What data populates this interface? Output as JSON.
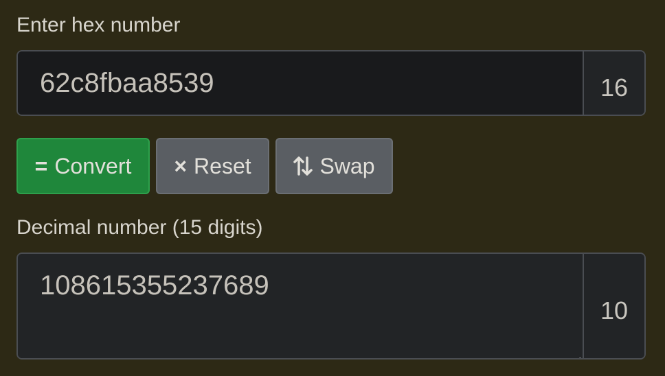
{
  "input": {
    "label": "Enter hex number",
    "value": "62c8fbaa8539",
    "base": "16"
  },
  "buttons": {
    "convert_icon": "=",
    "convert_label": "Convert",
    "reset_icon": "×",
    "reset_label": "Reset",
    "swap_label": "Swap"
  },
  "output": {
    "label": "Decimal number (15 digits)",
    "value": "108615355237689",
    "base": "10"
  },
  "icons": {
    "swap": "up-down-arrows-icon",
    "reset": "close-icon",
    "convert": "equals-icon"
  },
  "colors": {
    "background": "#2d2915",
    "convert_button": "#1f873b",
    "secondary_button": "#5a5e63"
  }
}
